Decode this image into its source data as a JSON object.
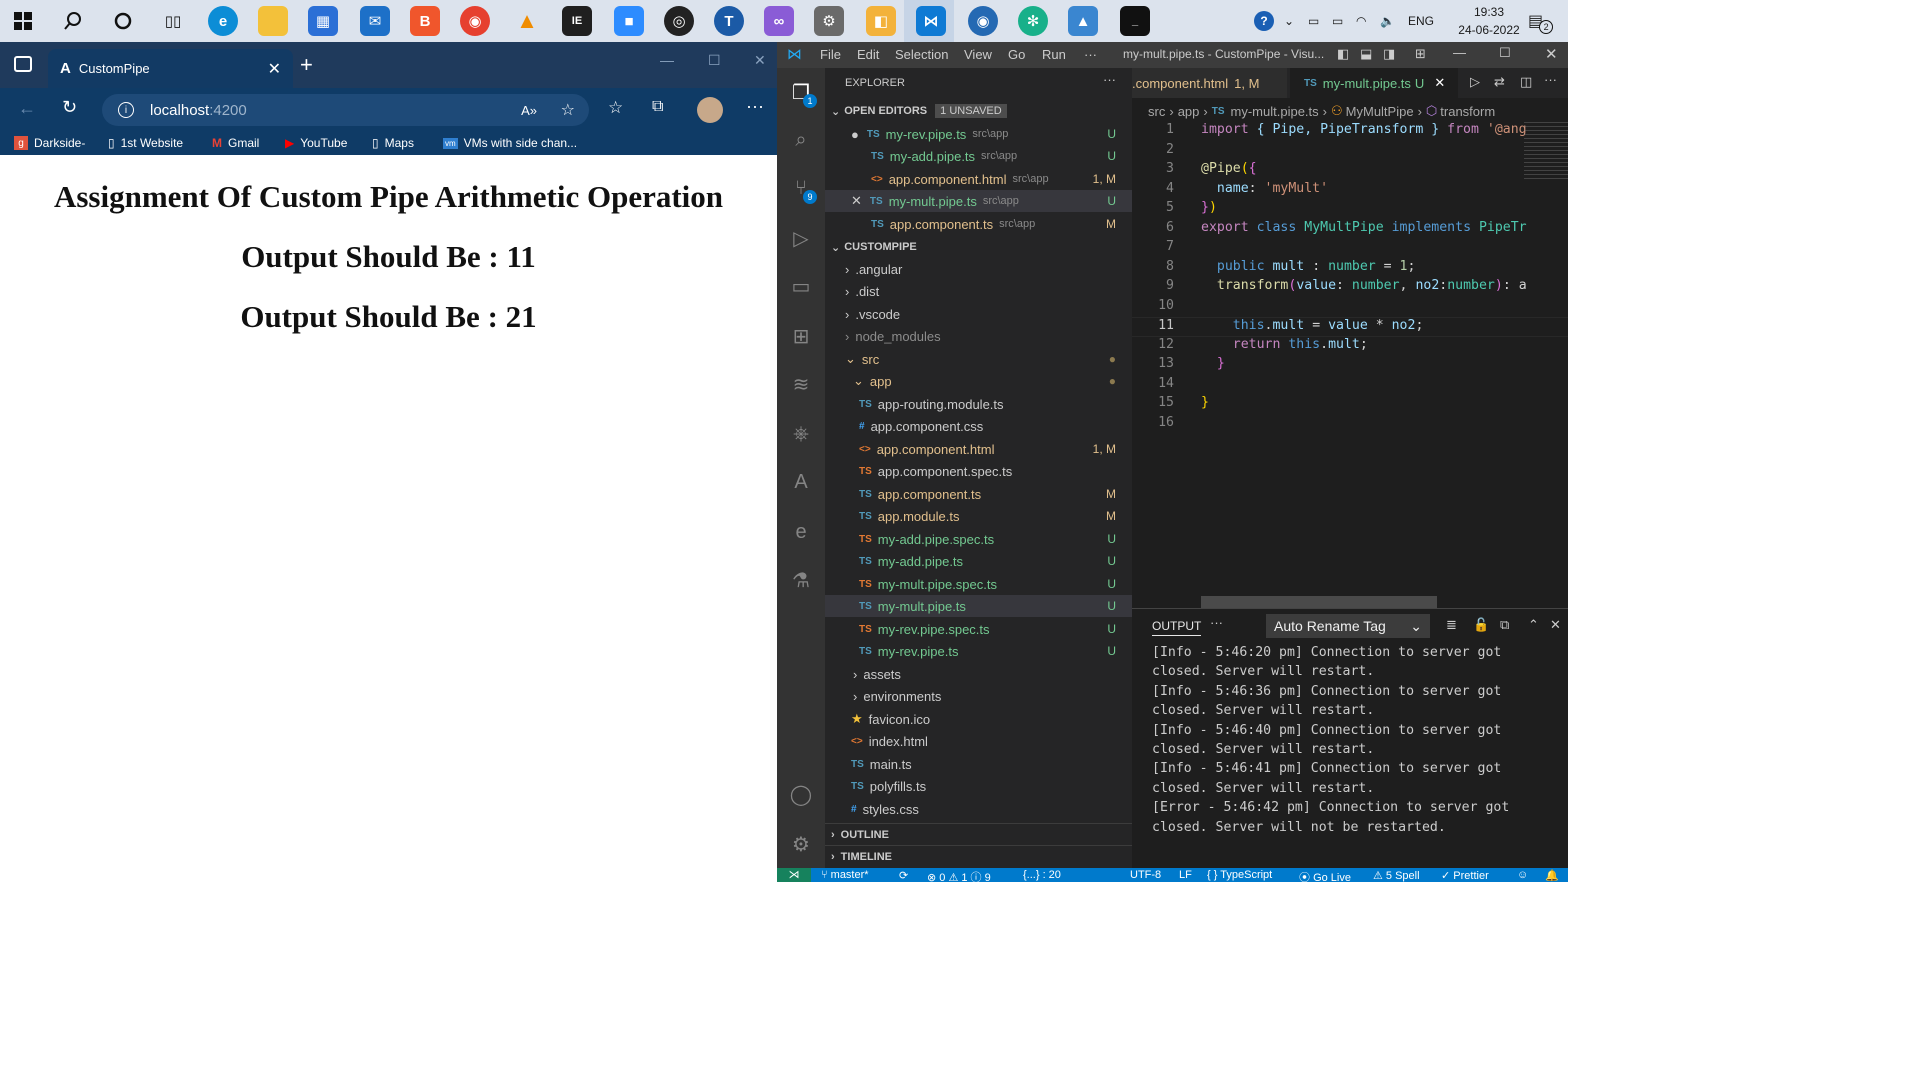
{
  "taskbar": {
    "time": "19:33",
    "date": "24-06-2022",
    "lang": "ENG",
    "notif_count": "2"
  },
  "browser": {
    "tab_title": "CustomPipe",
    "url_host": "localhost",
    "url_port": ":4200",
    "favorites": [
      "Darkside-",
      "1st Website",
      "Gmail",
      "YouTube",
      "Maps",
      "VMs with side chan..."
    ]
  },
  "page": {
    "heading": "Assignment Of Custom Pipe Arithmetic Operation",
    "output1": "Output Should Be : 11",
    "output2": "Output Should Be : 21"
  },
  "vscode": {
    "menu": [
      "File",
      "Edit",
      "Selection",
      "View",
      "Go",
      "Run",
      "···"
    ],
    "window_title": "my-mult.pipe.ts - CustomPipe - Visu...",
    "explorer_label": "EXPLORER",
    "open_editors_label": "OPEN EDITORS",
    "unsaved_badge": "1 UNSAVED",
    "open_editors": [
      {
        "name": "my-rev.pipe.ts",
        "path": "src\\app",
        "badge": "U"
      },
      {
        "name": "my-add.pipe.ts",
        "path": "src\\app",
        "badge": "U"
      },
      {
        "name": "app.component.html",
        "path": "src\\app",
        "badge": "1, M"
      },
      {
        "name": "my-mult.pipe.ts",
        "path": "src\\app",
        "badge": "U"
      },
      {
        "name": "app.component.ts",
        "path": "src\\app",
        "badge": "M"
      }
    ],
    "project_label": "CUSTOMPIPE",
    "folders_top": [
      ".angular",
      ".dist",
      ".vscode",
      "node_modules"
    ],
    "src_label": "src",
    "app_label": "app",
    "app_files": [
      {
        "name": "app-routing.module.ts",
        "badge": ""
      },
      {
        "name": "app.component.css",
        "badge": ""
      },
      {
        "name": "app.component.html",
        "badge": "1, M"
      },
      {
        "name": "app.component.spec.ts",
        "badge": ""
      },
      {
        "name": "app.component.ts",
        "badge": "M"
      },
      {
        "name": "app.module.ts",
        "badge": "M"
      },
      {
        "name": "my-add.pipe.spec.ts",
        "badge": "U"
      },
      {
        "name": "my-add.pipe.ts",
        "badge": "U"
      },
      {
        "name": "my-mult.pipe.spec.ts",
        "badge": "U"
      },
      {
        "name": "my-mult.pipe.ts",
        "badge": "U"
      },
      {
        "name": "my-rev.pipe.spec.ts",
        "badge": "U"
      },
      {
        "name": "my-rev.pipe.ts",
        "badge": "U"
      }
    ],
    "src_rest": [
      "assets",
      "environments",
      "favicon.ico",
      "index.html",
      "main.ts",
      "polyfills.ts",
      "styles.css"
    ],
    "outline_label": "OUTLINE",
    "timeline_label": "TIMELINE",
    "tabs": [
      {
        "name": ".component.html",
        "badge": "1, M"
      },
      {
        "name": "my-mult.pipe.ts",
        "badge": "U"
      }
    ],
    "breadcrumb": [
      "src",
      "app",
      "my-mult.pipe.ts",
      "MyMultPipe",
      "transform"
    ],
    "code_lines": [
      "1",
      "2",
      "3",
      "4",
      "5",
      "6",
      "7",
      "8",
      "9",
      "10",
      "11",
      "12",
      "13",
      "14",
      "15",
      "16"
    ],
    "code": {
      "l1_import": "import",
      "l1_names": "{ Pipe, PipeTransform }",
      "l1_from": "from",
      "l1_mod": "'@ang",
      "l3": "@Pipe",
      "l4_key": "name",
      "l4_val": "'myMult'",
      "l6_export": "export",
      "l6_class": "class",
      "l6_name": "MyMultPipe",
      "l6_impl": "implements",
      "l6_iface": "PipeTr",
      "l8_public": "public",
      "l8_var": "mult",
      "l8_type": "number",
      "l8_num": "1",
      "l9_fn": "transform",
      "l9_p1": "value",
      "l9_t1": "number",
      "l9_p2": "no2",
      "l9_t2": "number",
      "l11_this": "this",
      "l11_var": "mult",
      "l11_value": "value",
      "l11_no2": "no2",
      "l12_return": "return",
      "l12_this": "this",
      "l12_var": "mult"
    },
    "panel_label": "OUTPUT",
    "panel_select": "Auto Rename Tag",
    "output_lines": [
      "[Info  - 5:46:20 pm] Connection to server got",
      "closed. Server will restart.",
      "[Info  - 5:46:36 pm] Connection to server got",
      "closed. Server will restart.",
      "[Info  - 5:46:40 pm] Connection to server got",
      "closed. Server will restart.",
      "[Info  - 5:46:41 pm] Connection to server got",
      "closed. Server will restart.",
      "[Error - 5:46:42 pm] Connection to server got",
      "closed. Server will not be restarted."
    ],
    "status": {
      "branch": "master*",
      "problems": "⊗ 0 ⚠ 1 ⓘ 9",
      "braces": "{...} : 20",
      "encoding": "UTF-8",
      "eol": "LF",
      "lang": "{ } TypeScript",
      "golive": "Go Live",
      "spell": "5 Spell",
      "prettier": "Prettier"
    },
    "scm_badge": "9",
    "explorer_badge": "1"
  }
}
